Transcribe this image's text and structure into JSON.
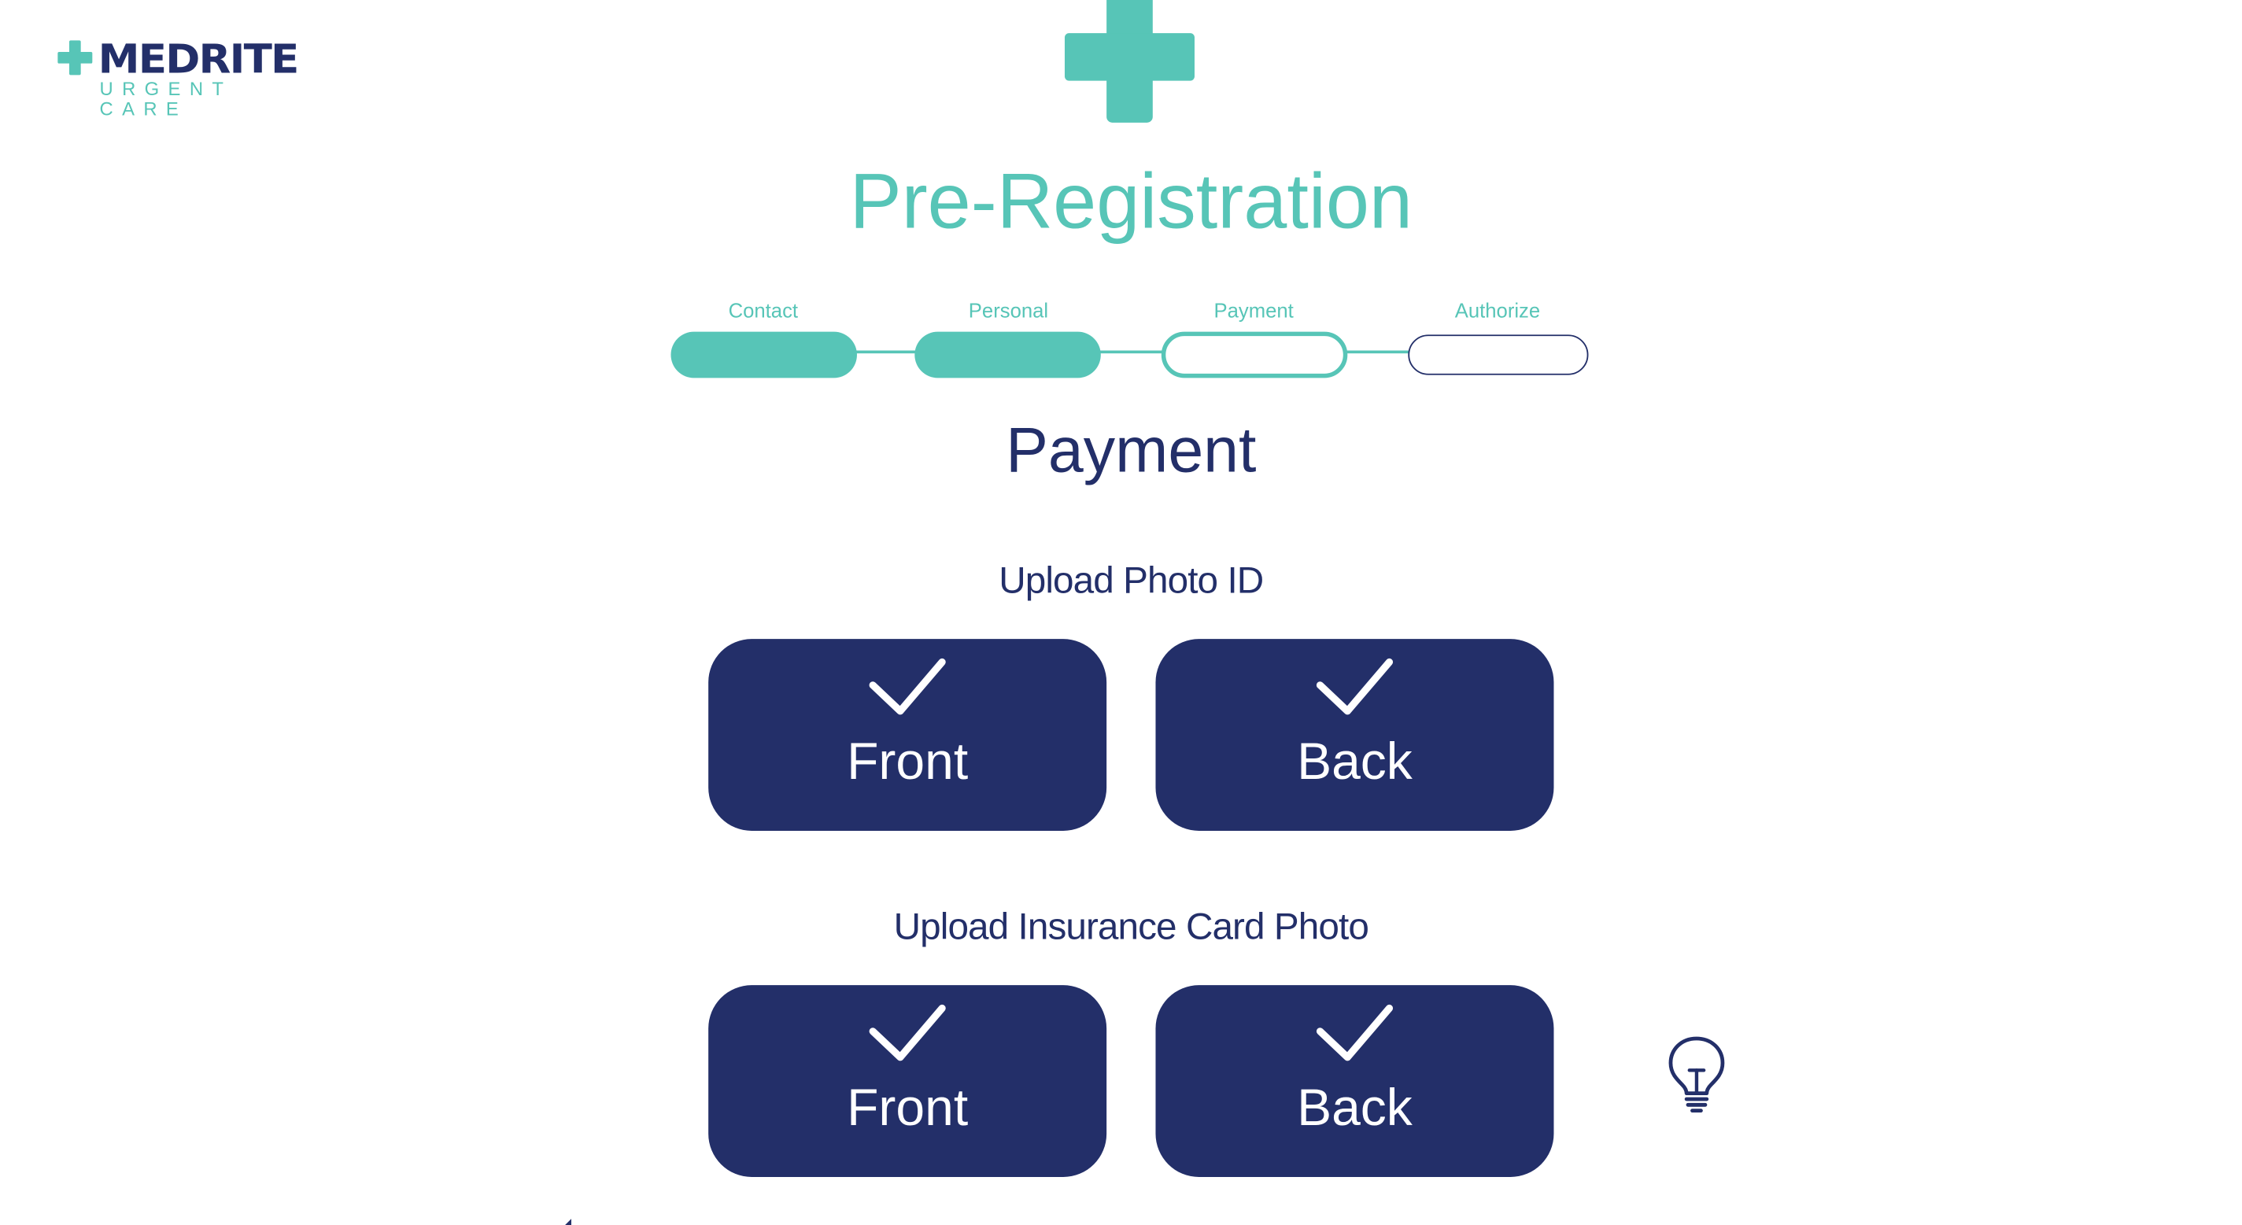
{
  "brand": {
    "name": "MEDRITE",
    "tagline": "URGENT CARE"
  },
  "colors": {
    "accent": "#57c5b7",
    "primary": "#232f69",
    "background": "#ffffff"
  },
  "page_title": "Pre-Registration",
  "stepper": {
    "steps": [
      {
        "label": "Contact",
        "state": "complete"
      },
      {
        "label": "Personal",
        "state": "complete"
      },
      {
        "label": "Payment",
        "state": "current"
      },
      {
        "label": "Authorize",
        "state": "upcoming"
      }
    ]
  },
  "section_title": "Payment",
  "photo_id": {
    "heading": "Upload Photo ID",
    "front": {
      "label": "Front",
      "uploaded": true,
      "icon": "check-icon"
    },
    "back": {
      "label": "Back",
      "uploaded": true,
      "icon": "check-icon"
    }
  },
  "insurance_card": {
    "heading": "Upload Insurance Card Photo",
    "front": {
      "label": "Front",
      "uploaded": true,
      "icon": "check-icon"
    },
    "back": {
      "label": "Back",
      "uploaded": true,
      "icon": "check-icon"
    }
  },
  "icons": {
    "help": "lightbulb-icon",
    "logo": "medical-cross-icon"
  }
}
